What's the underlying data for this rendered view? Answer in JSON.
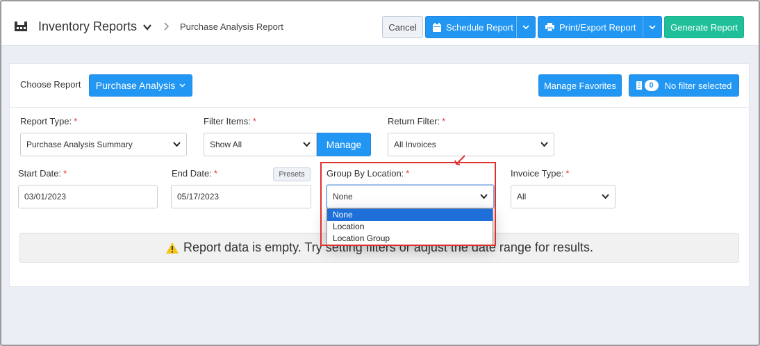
{
  "header": {
    "app_title": "Inventory Reports",
    "breadcrumb": "Purchase Analysis Report",
    "cancel_label": "Cancel",
    "schedule_label": "Schedule Report",
    "print_label": "Print/Export Report",
    "generate_label": "Generate Report"
  },
  "toolbar": {
    "choose_label": "Choose Report",
    "choose_value": "Purchase Analysis",
    "favorites_label": "Manage Favorites",
    "filter_count": "0",
    "filter_label": "No filter selected"
  },
  "form": {
    "report_type": {
      "label": "Report Type:",
      "required": "*",
      "value": "Purchase Analysis Summary"
    },
    "filter_items": {
      "label": "Filter Items:",
      "required": "*",
      "value": "Show All",
      "manage_label": "Manage"
    },
    "return_filter": {
      "label": "Return Filter:",
      "required": "*",
      "value": "All Invoices"
    },
    "start_date": {
      "label": "Start Date:",
      "required": "*",
      "value": "03/01/2023"
    },
    "end_date": {
      "label": "End Date:",
      "required": "*",
      "value": "05/17/2023",
      "presets_label": "Presets"
    },
    "group_by_location": {
      "label": "Group By Location:",
      "required": "*",
      "value": "None",
      "options": [
        "None",
        "Location",
        "Location Group"
      ],
      "selected_index": 0
    },
    "invoice_type": {
      "label": "Invoice Type:",
      "required": "*",
      "value": "All"
    }
  },
  "notice": {
    "text": "Report data is empty. Try setting filters or adjust the date range for results."
  },
  "colors": {
    "primary": "#2196f3",
    "success": "#1fbf9a",
    "highlight": "#e0302e",
    "warning": "#f5c518"
  }
}
